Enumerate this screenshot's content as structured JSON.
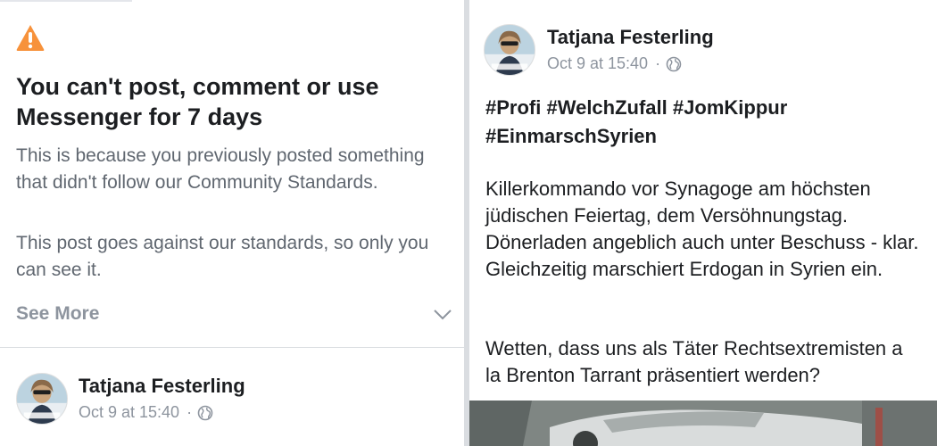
{
  "notice": {
    "icon": "warning-triangle-icon",
    "icon_color": "#f7923b",
    "title": "You can't post, comment or use Messenger for 7 days",
    "body": "This is because you previously posted something that didn't follow our Community Standards.",
    "extra": "This post goes against our standards, so only you can see it.",
    "see_more": "See More"
  },
  "left_post": {
    "author": "Tatjana Festerling",
    "date": "Oct 9 at 15:40",
    "separator": "·",
    "privacy_icon": "globe-icon"
  },
  "right_post": {
    "author": "Tatjana Festerling",
    "date": "Oct 9 at 15:40",
    "separator": "·",
    "privacy_icon": "globe-icon",
    "hashtags": [
      "#Profi",
      "#WelchZufall",
      "#JomKippur",
      "#EinmarschSyrien"
    ],
    "paragraph1": "Killerkommando vor Synagoge am höchsten jüdischen Feiertag, dem Versöhnungstag. Dönerladen angeblich auch unter Beschuss - klar. Gleichzeitig marschiert Erdogan in Syrien ein.",
    "paragraph2": "Wetten, dass uns als Täter Rechtsextremisten a la Brenton Tarrant präsentiert werden?"
  },
  "colors": {
    "text_primary": "#1c1e21",
    "text_secondary": "#606770",
    "text_muted": "#8d949e",
    "warning": "#f7923b",
    "divider": "#dadde1"
  }
}
